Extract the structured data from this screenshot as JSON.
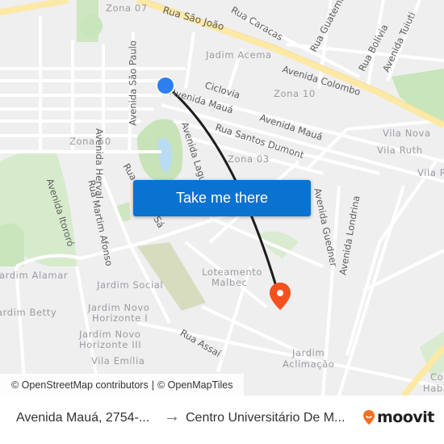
{
  "map": {
    "labels": {
      "zona07": "Zona 07",
      "ruaSaoJoao": "Rua São João",
      "ruaCaracas": "Rua Caracas",
      "ruaGuatemala": "Rua Guatemala",
      "ruaBolivia": "Rua Bolívia",
      "avTuiuti": "Avenida Tuiuti",
      "jardimAcema": "Jadim Acema",
      "avColombo": "Avenida Colombo",
      "ciclovia": "Ciclovia",
      "avMaua1": "Avenida Mauá",
      "avMaua2": "Avenida Mauá",
      "zona10": "Zona 10",
      "ruaSantosDumont": "Rua Santos Dumont",
      "avSaoPaulo": "Avenida São Paulo",
      "avHerval": "Avenida Herval",
      "avLaguna": "Avenida Laguna",
      "zona50": "Zona 50",
      "zona03": "Zona 03",
      "vilaNova": "Vila Nova",
      "vilaRuth": "Vila Ruth",
      "vilaR": "Vila R",
      "avItororo": "Avenida Itororó",
      "ruaMartimAfonso": "Rua Martim Afonso",
      "ruaMemDeSa": "Rua Mem de Sá",
      "avGuedner": "Avenida Guedner",
      "avLondrina": "Avenida Londrina",
      "jardimAlamar": "Jardim Alamar",
      "jardimSocial": "Jardim Social",
      "loteamentoMalbec1": "Loteamento",
      "loteamentoMalbec2": "Malbec",
      "jardimBetty": "Jardim Betty",
      "jardimNovoHorizonteI_1": "Jardim Novo",
      "jardimNovoHorizonteI_2": "Horizonte I",
      "jardimNovoHorizonteIII_1": "Jardim Novo",
      "jardimNovoHorizonteIII_2": "Horizonte III",
      "ruaAssai": "Rua Assaí",
      "vilaEmilia": "Vila Emília",
      "jardimAclimacao1": "Jardim",
      "jardimAclimacao2": "Aclimação",
      "conjHab1": "Co",
      "conjHab2": "Habi"
    },
    "origin_marker_color": "#2d7ff0",
    "destination_marker_color": "#f4511e",
    "route_color": "#1c1c1c",
    "take_me_there": "Take me there",
    "attribution": {
      "osm": "© OpenStreetMap contributors",
      "separator": "|",
      "omt": "© OpenMapTiles"
    }
  },
  "bottom_bar": {
    "from": "Avenida Mauá, 2754-...",
    "arrow": "→",
    "to": "Centro Universitário De M...",
    "brand": "moovit",
    "brand_color": "#f36f21"
  }
}
